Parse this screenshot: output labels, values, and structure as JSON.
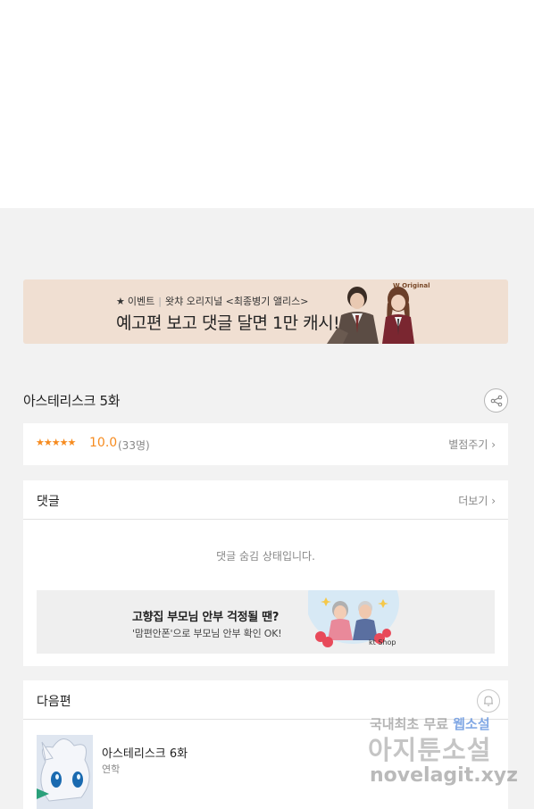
{
  "banner": {
    "star": "★",
    "event_label": "이벤트",
    "divider": "|",
    "event_detail": "왓챠 오리지널 <최종병기 앨리스>",
    "headline": "예고편 보고 댓글 달면 1만 캐시!",
    "logo": "W Original"
  },
  "episode": {
    "title": "아스테리스크 5화"
  },
  "rating": {
    "stars": "★★★★★",
    "score": "10.0",
    "count": "(33명)",
    "rate_link": "별점주기 ›"
  },
  "comments": {
    "title": "댓글",
    "more": "더보기 ›",
    "hidden_message": "댓글 숨김 상태입니다."
  },
  "ad": {
    "title": "고향집 부모님 안부 걱정될 땐?",
    "subtitle": "'맘편안폰'으로 부모님 안부 확인 OK!",
    "brand": "kt Shop"
  },
  "next": {
    "title": "다음편",
    "episode_title": "아스테리스크 6화",
    "status": "연학"
  },
  "watermark": {
    "line1_a": "국내최초 무료 ",
    "line1_b": "웹소설",
    "line2": "아지툰소설",
    "line3": "novelagit.xyz"
  },
  "colors": {
    "accent_orange": "#f68b1f",
    "banner_bg": "#f0dfd2",
    "page_bg": "#f2f2f2"
  }
}
